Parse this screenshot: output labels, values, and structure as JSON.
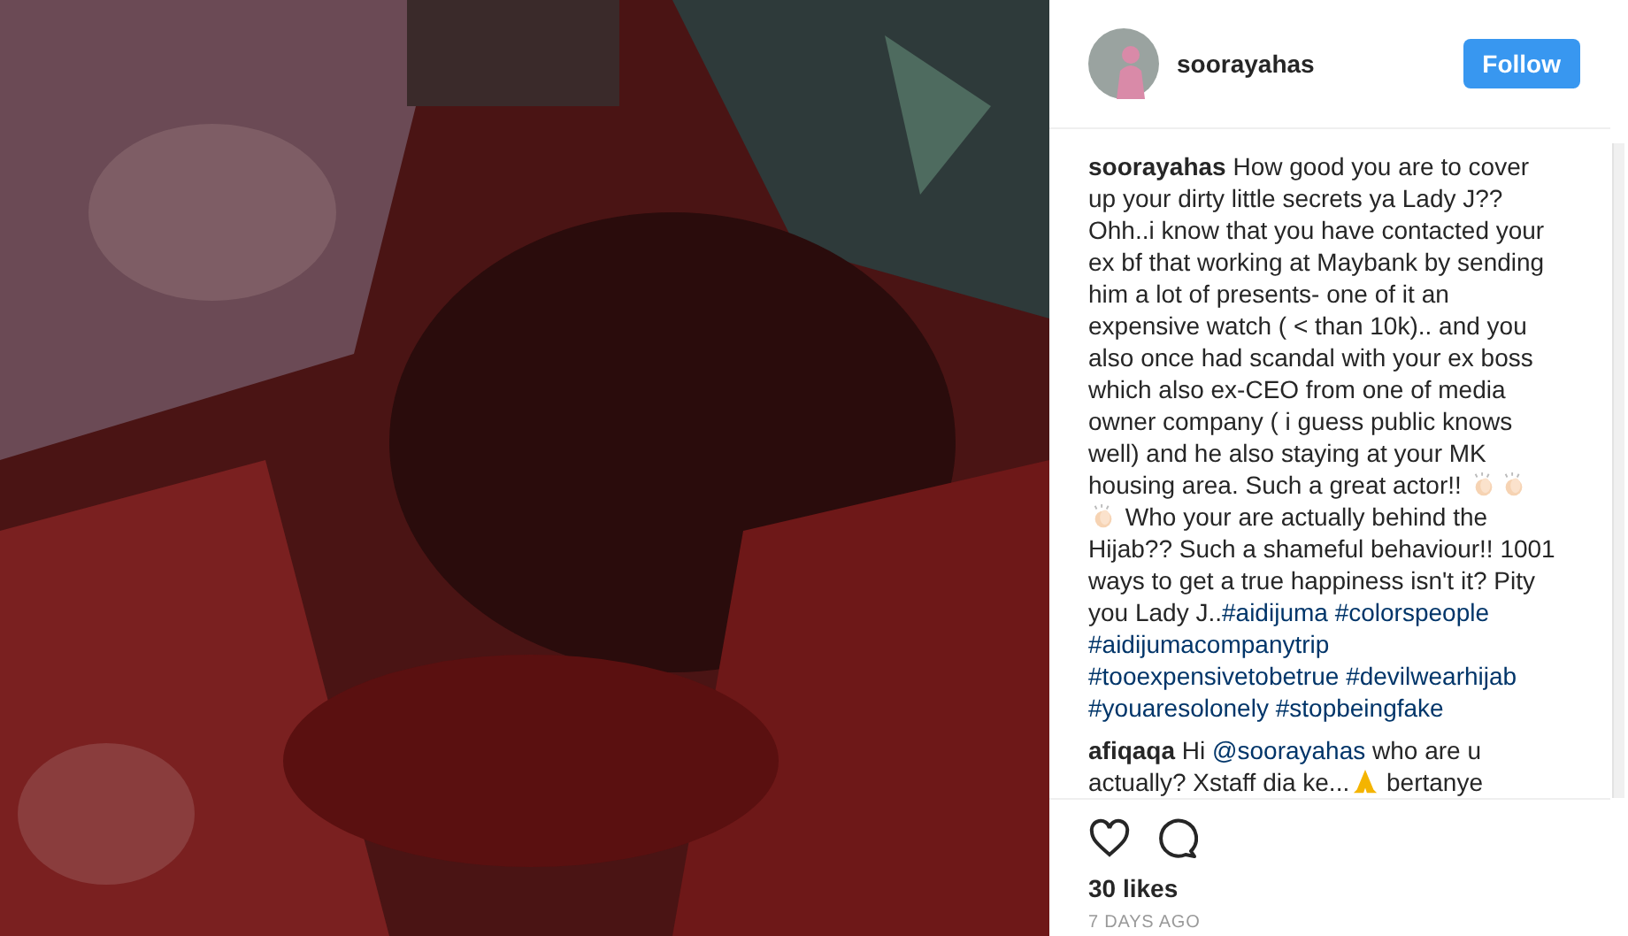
{
  "header": {
    "username": "soorayahas",
    "follow_button": "Follow"
  },
  "comments": [
    {
      "username": "soorayahas",
      "segments": [
        {
          "kind": "text",
          "text": "How good you are to cover up your dirty little secrets ya Lady J?? Ohh..i know that you have contacted your ex bf that working at Maybank by sending him a lot of presents- one of it an expensive watch ( < than 10k).. and you also once had scandal with your ex boss which also ex-CEO from one of media owner company ( i guess public knows well) and he also staying at your MK housing area. Such a great actor!! "
        },
        {
          "kind": "clap"
        },
        {
          "kind": "clap"
        },
        {
          "kind": "clap"
        },
        {
          "kind": "text",
          "text": " Who your are actually behind the Hijab?? Such a shameful behaviour!! 1001 ways to get a true happiness isn't it? Pity you Lady J.."
        },
        {
          "kind": "link",
          "text": "#aidijuma"
        },
        {
          "kind": "link",
          "text": "#colorspeople"
        },
        {
          "kind": "link",
          "text": "#aidijumacompanytrip"
        },
        {
          "kind": "link",
          "text": "#tooexpensivetobetrue"
        },
        {
          "kind": "link",
          "text": "#devilwearhijab"
        },
        {
          "kind": "link",
          "text": "#youaresolonely"
        },
        {
          "kind": "link",
          "text": "#stopbeingfake"
        }
      ]
    },
    {
      "username": "afiqaqa",
      "segments": [
        {
          "kind": "text",
          "text": "Hi "
        },
        {
          "kind": "link",
          "text": "@soorayahas"
        },
        {
          "kind": "text",
          "text": " who are u actually? Xstaff dia ke..."
        },
        {
          "kind": "pray"
        },
        {
          "kind": "text",
          "text": " bertanye"
        }
      ]
    }
  ],
  "likes": "30 likes",
  "timestamp": "7 DAYS AGO"
}
